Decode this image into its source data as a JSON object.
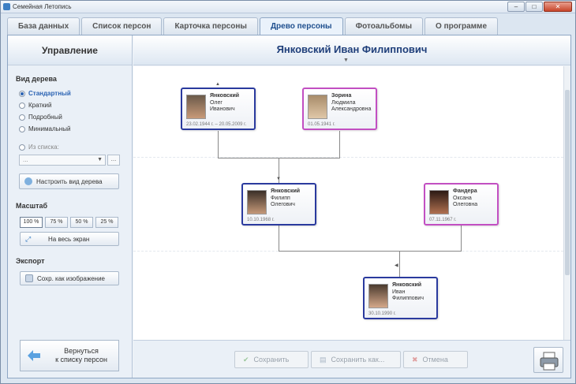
{
  "window": {
    "title": "Семейная Летопись"
  },
  "tabs": [
    {
      "label": "База данных"
    },
    {
      "label": "Список персон"
    },
    {
      "label": "Карточка персоны"
    },
    {
      "label": "Древо персоны"
    },
    {
      "label": "Фотоальбомы"
    },
    {
      "label": "О программе"
    }
  ],
  "left": {
    "header": "Управление",
    "tree_view_title": "Вид дерева",
    "tree_types": [
      "Стандартный",
      "Краткий",
      "Подробный",
      "Минимальный"
    ],
    "from_list_label": "Из списка:",
    "combo_value": "...",
    "combo_button": "...",
    "configure_label": "Настроить вид дерева",
    "scale_title": "Масштаб",
    "scales": [
      "100 %",
      "75 %",
      "50 %",
      "25 %"
    ],
    "fullscreen_label": "На весь экран",
    "export_title": "Экспорт",
    "save_image_label": "Сохр. как изображение",
    "back_label_1": "Вернуться",
    "back_label_2": "к списку персон"
  },
  "main": {
    "title": "Янковский  Иван  Филиппович"
  },
  "persons": [
    {
      "surname": "Янковский",
      "name": "Олег",
      "patronymic": "Иванович",
      "dates": "23.02.1944 г. – 20.05.2009 г.",
      "gender": "male"
    },
    {
      "surname": "Зорина",
      "name": "Людмила",
      "patronymic": "Александровна",
      "dates": "01.05.1941 г.",
      "gender": "female"
    },
    {
      "surname": "Янковский",
      "name": "Филипп",
      "patronymic": "Олегович",
      "dates": "10.10.1968 г.",
      "gender": "male"
    },
    {
      "surname": "Фандера",
      "name": "Оксана",
      "patronymic": "Олеговна",
      "dates": "07.11.1967 г.",
      "gender": "female"
    },
    {
      "surname": "Янковский",
      "name": "Иван",
      "patronymic": "Филиппович",
      "dates": "30.10.1990 г.",
      "gender": "male"
    }
  ],
  "actions": {
    "save": "Сохранить",
    "save_as": "Сохранить как...",
    "cancel": "Отмена"
  }
}
